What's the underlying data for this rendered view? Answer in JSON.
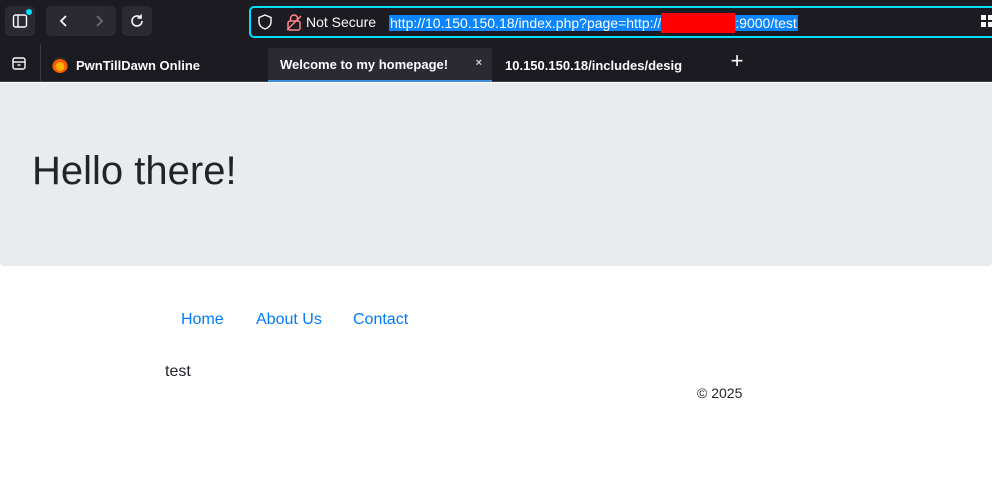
{
  "browser": {
    "security_label": "Not Secure",
    "url": {
      "prefix": "http://10.150.150.18/index.php?page=http://",
      "suffix": ":9000/test"
    },
    "tabs": [
      {
        "label": "PwnTillDawn Online",
        "active": false
      },
      {
        "label": "Welcome to my homepage!",
        "active": true,
        "close": "×"
      },
      {
        "label": "10.150.150.18/includes/desig",
        "active": false
      }
    ],
    "new_tab": "+"
  },
  "page": {
    "heading": "Hello there!",
    "nav": [
      "Home",
      "About Us",
      "Contact"
    ],
    "content": "test",
    "footer": "© 2025",
    "link_color": "#007bff",
    "hero_bg": "#e9ecef"
  }
}
